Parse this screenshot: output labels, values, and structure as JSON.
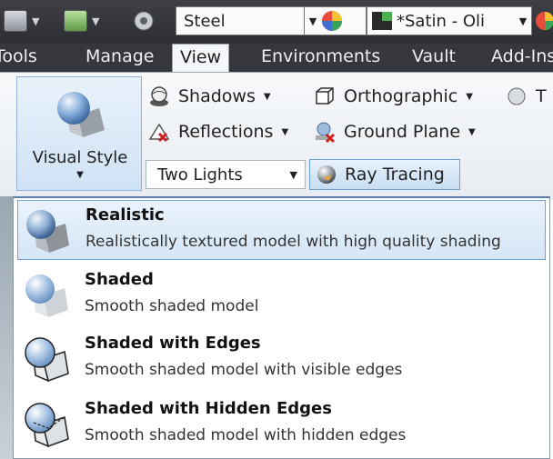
{
  "quick_access": {
    "material": "Steel",
    "appearance": "*Satin - Oli"
  },
  "ribbon": {
    "tabs": [
      {
        "label": "Tools"
      },
      {
        "label": "Manage"
      },
      {
        "label": "View"
      },
      {
        "label": "Environments"
      },
      {
        "label": "Vault"
      },
      {
        "label": "Add-Ins"
      }
    ],
    "active_tab": "View",
    "visual_style_label": "Visual Style",
    "shadows_label": "Shadows",
    "reflections_label": "Reflections",
    "orthographic_label": "Orthographic",
    "ground_plane_label": "Ground Plane",
    "lighting_value": "Two Lights",
    "ray_tracing_label": "Ray Tracing",
    "truncated_label": "T"
  },
  "menu": {
    "items": [
      {
        "title": "Realistic",
        "desc": "Realistically textured model with high quality shading",
        "icon": "realistic-style-icon"
      },
      {
        "title": "Shaded",
        "desc": "Smooth shaded model",
        "icon": "shaded-style-icon"
      },
      {
        "title": "Shaded with Edges",
        "desc": "Smooth shaded model with visible edges",
        "icon": "shaded-edges-style-icon"
      },
      {
        "title": "Shaded with Hidden Edges",
        "desc": "Smooth shaded model with hidden edges",
        "icon": "shaded-hidden-edges-style-icon"
      }
    ],
    "selected": "Realistic"
  },
  "colors": {
    "accent": "#5a7ea8",
    "highlight": "#d5e6f6",
    "ribbon_dark": "#35373c"
  }
}
